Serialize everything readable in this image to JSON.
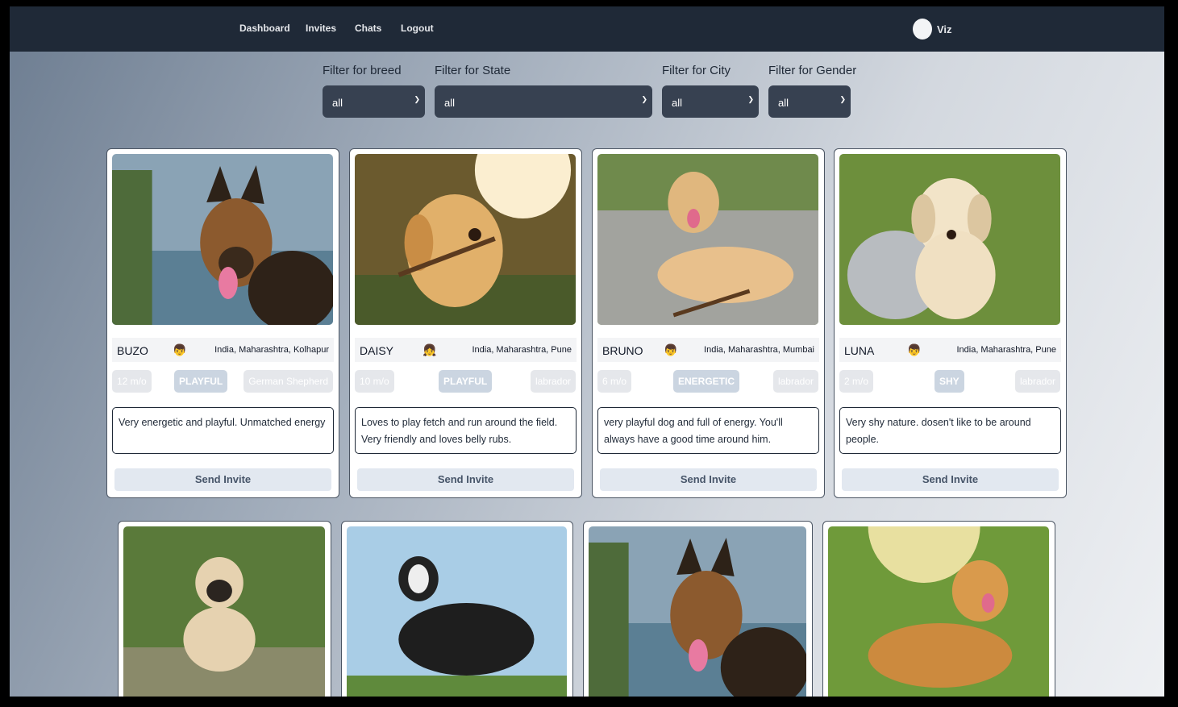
{
  "nav": {
    "links": [
      "Dashboard",
      "Invites",
      "Chats",
      "Logout"
    ],
    "username": "Viz"
  },
  "filters": [
    {
      "label": "Filter for breed",
      "value": "all"
    },
    {
      "label": "Filter for State",
      "value": "all"
    },
    {
      "label": "Filter for City",
      "value": "all"
    },
    {
      "label": "Filter for Gender",
      "value": "all"
    }
  ],
  "dogs": [
    {
      "name": "BUZO",
      "gender_icon": "boy-emoji-icon",
      "location": "India, Maharashtra, Kolhapur",
      "age": "12 m/o",
      "trait": "PLAYFUL",
      "breed": "German Shepherd",
      "description": "Very energetic and playful. Unmatched energy",
      "button": "Send Invite"
    },
    {
      "name": "DAISY",
      "gender_icon": "girl-emoji-icon",
      "location": "India, Maharashtra, Pune",
      "age": "10 m/o",
      "trait": "PLAYFUL",
      "breed": "labrador",
      "description": "Loves to play fetch and run around the field. Very friendly and loves belly rubs.",
      "button": "Send Invite"
    },
    {
      "name": "BRUNO",
      "gender_icon": "boy-emoji-icon",
      "location": "India, Maharashtra, Mumbai",
      "age": "6 m/o",
      "trait": "ENERGETIC",
      "breed": "labrador",
      "description": "very playful dog and full of energy. You'll always have a good time around him.",
      "button": "Send Invite"
    },
    {
      "name": "LUNA",
      "gender_icon": "boy-emoji-icon",
      "location": "India, Maharashtra, Pune",
      "age": "2 m/o",
      "trait": "SHY",
      "breed": "labrador",
      "description": "Very shy nature. dosen't like to be around people.",
      "button": "Send Invite"
    }
  ],
  "colors": {
    "navbar": "#1f2937",
    "select": "#374151",
    "button": "#e2e8f0"
  }
}
